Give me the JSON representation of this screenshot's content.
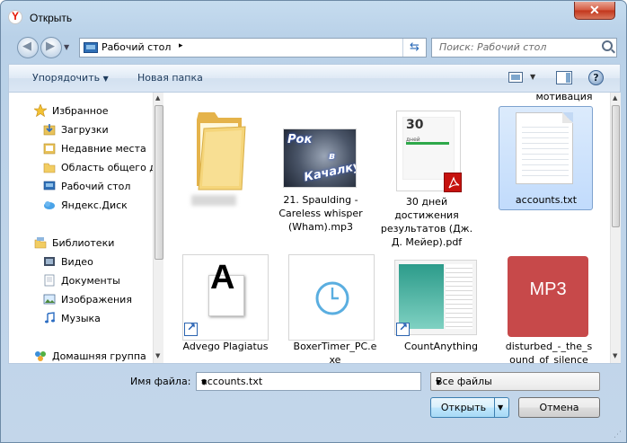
{
  "window": {
    "title": "Открыть",
    "close_glyph": "✕"
  },
  "address": {
    "crumb": "Рабочий стол",
    "crumb_arrow": "▸",
    "refresh_glyph": "⇆"
  },
  "search": {
    "placeholder": "Поиск: Рабочий стол"
  },
  "toolbar": {
    "organize_label": "Упорядочить",
    "new_folder_label": "Новая папка",
    "help_glyph": "?"
  },
  "nav": {
    "items": [
      {
        "label": "Избранное",
        "icon": "star-icon"
      },
      {
        "label": "Загрузки",
        "icon": "downloads-icon"
      },
      {
        "label": "Недавние места",
        "icon": "recent-places-icon"
      },
      {
        "label": "Область общего д",
        "icon": "folder-icon"
      },
      {
        "label": "Рабочий стол",
        "icon": "desktop-icon"
      },
      {
        "label": "Яндекс.Диск",
        "icon": "yandex-disk-icon"
      },
      {
        "label": "Библиотеки",
        "icon": "libraries-icon"
      },
      {
        "label": "Видео",
        "icon": "video-icon"
      },
      {
        "label": "Документы",
        "icon": "documents-icon"
      },
      {
        "label": "Изображения",
        "icon": "pictures-icon"
      },
      {
        "label": "Музыка",
        "icon": "music-icon"
      },
      {
        "label": "Домашняя группа",
        "icon": "homegroup-icon"
      }
    ]
  },
  "files": {
    "top_partial_label": "мотивация",
    "items": [
      {
        "line1": "",
        "line2": "",
        "line3": "",
        "icon": "folder-icon"
      },
      {
        "line1": "21. Spaulding -",
        "line2": "Careless whisper",
        "line3": "(Wham).mp3",
        "icon": "album-art-icon",
        "art_text1": "Рок",
        "art_text2": "в",
        "art_text3": "Качалку"
      },
      {
        "line1": "30 дней",
        "line2": "достижения",
        "line3": "результатов (Дж.",
        "line4": "Д. Мейер).pdf",
        "icon": "pdf-book-icon",
        "book_num": "30",
        "book_sub": "дней"
      },
      {
        "line1": "accounts.txt",
        "icon": "text-file-icon"
      },
      {
        "line1": "Advego Plagiatus",
        "icon": "advego-icon",
        "glyph": "A"
      },
      {
        "line1": "BoxerTimer_PC.e",
        "line2": "xe",
        "icon": "clock-icon"
      },
      {
        "line1": "CountAnything",
        "icon": "app-window-icon"
      },
      {
        "line1": "disturbed_-_the_s",
        "line2": "ound_of_silence",
        "icon": "mp3-icon",
        "badge": "MP3"
      }
    ]
  },
  "footer": {
    "filename_label": "Имя файла:",
    "filename_value": "accounts.txt",
    "filetype_value": "Все файлы",
    "open_label": "Открыть",
    "cancel_label": "Отмена"
  }
}
